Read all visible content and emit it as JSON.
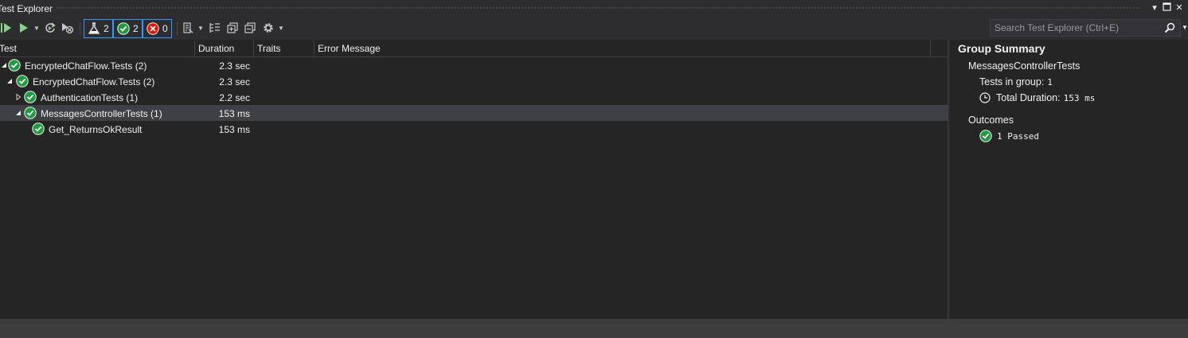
{
  "window": {
    "title": "Test Explorer"
  },
  "toolbar": {
    "filters": [
      {
        "icon": "flask-icon",
        "count": "2"
      },
      {
        "icon": "passed-icon",
        "count": "2"
      },
      {
        "icon": "failed-icon",
        "count": "0"
      }
    ]
  },
  "search": {
    "placeholder": "Search Test Explorer (Ctrl+E)",
    "value": ""
  },
  "grid": {
    "columns": [
      "Test",
      "Duration",
      "Traits",
      "Error Message"
    ],
    "rows": [
      {
        "name": "EncryptedChatFlow.Tests  (2)",
        "duration": "2.3 sec",
        "state": "expanded",
        "selected": false
      },
      {
        "name": "EncryptedChatFlow.Tests  (2)",
        "duration": "2.3 sec",
        "state": "expanded",
        "selected": false
      },
      {
        "name": "AuthenticationTests  (1)",
        "duration": "2.2 sec",
        "state": "collapsed",
        "selected": false
      },
      {
        "name": "MessagesControllerTests  (1)",
        "duration": "153 ms",
        "state": "expanded",
        "selected": true
      },
      {
        "name": "Get_ReturnsOkResult",
        "duration": "153 ms",
        "state": "leaf",
        "selected": false
      }
    ]
  },
  "summary": {
    "title": "Group Summary",
    "group_name": "MessagesControllerTests",
    "tests_in_group_label": "Tests in group:",
    "tests_in_group_value": "1",
    "total_duration_label": "Total Duration:",
    "total_duration_value": "153 ms",
    "outcomes_label": "Outcomes",
    "passed_text": "1 Passed"
  },
  "colors": {
    "background": "#252526",
    "toolbar": "#2d2d30",
    "selected_row": "#3f3f46",
    "passed": "#1f9a3f",
    "failed": "#e51400",
    "accent": "#3399ff"
  }
}
